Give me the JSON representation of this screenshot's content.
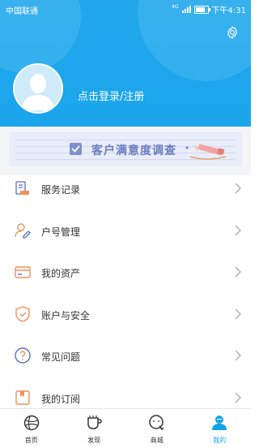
{
  "status_bar": {
    "carrier": "中国联通",
    "network": "4G",
    "time": "下午4:31"
  },
  "profile": {
    "login_text": "点击登录/注册"
  },
  "banner": {
    "text": "客户满意度调查"
  },
  "menu": [
    {
      "label": "服务记录",
      "icon": "service-record-icon"
    },
    {
      "label": "户号管理",
      "icon": "account-number-icon"
    },
    {
      "label": "我的资产",
      "icon": "assets-icon"
    },
    {
      "label": "账户与安全",
      "icon": "security-shield-icon"
    },
    {
      "label": "常见问题",
      "icon": "faq-icon"
    },
    {
      "label": "我的订阅",
      "icon": "subscription-icon"
    }
  ],
  "tabs": [
    {
      "label": "首页",
      "icon": "home-globe-icon",
      "active": false
    },
    {
      "label": "发现",
      "icon": "discover-cup-icon",
      "active": false
    },
    {
      "label": "商城",
      "icon": "mall-chat-icon",
      "active": false
    },
    {
      "label": "我的",
      "icon": "profile-person-icon",
      "active": true
    }
  ],
  "colors": {
    "header_blue": "#1aa6ec",
    "accent_orange": "#f0915a",
    "active_tab": "#12a4ea",
    "banner_text": "#6b7cc0"
  }
}
